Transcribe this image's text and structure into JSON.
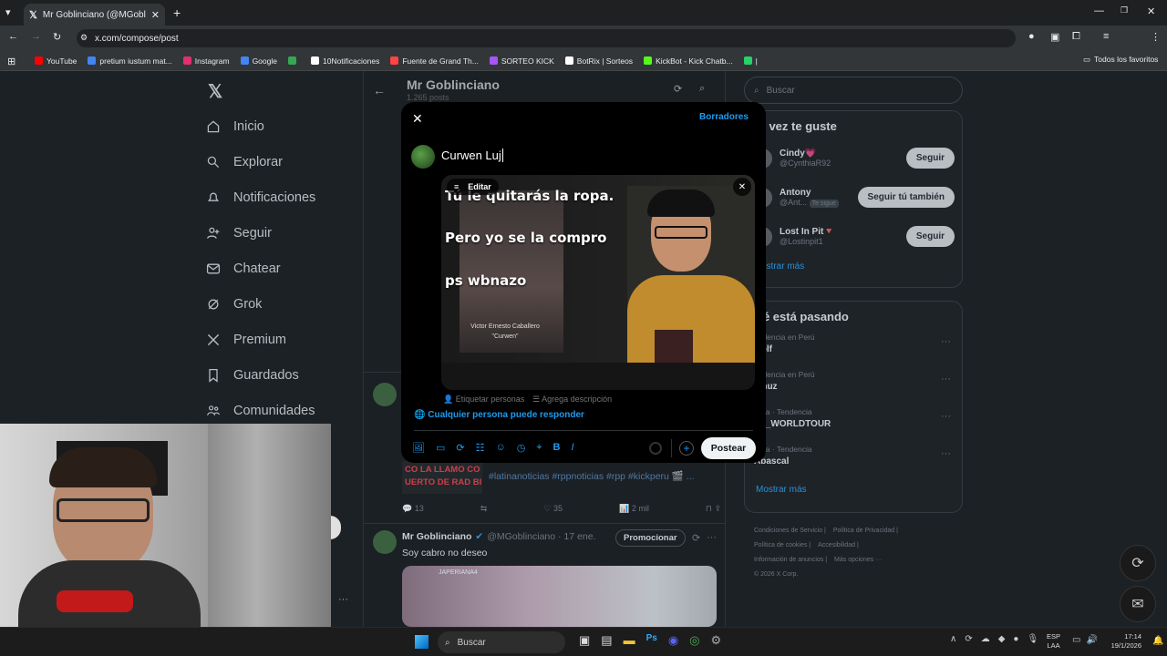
{
  "browser": {
    "tab_title": "Mr Goblinciano (@MGoblinciano",
    "url": "x.com/compose/post",
    "bookmarks": [
      {
        "label": "YouTube",
        "color": "#ff0000"
      },
      {
        "label": "pretium iustum mat...",
        "color": "#4285f4"
      },
      {
        "label": "Instagram",
        "color": "#e1306c"
      },
      {
        "label": "Google",
        "color": "#4285f4"
      },
      {
        "label": "",
        "color": "#34a853"
      },
      {
        "label": "10Notificaciones",
        "color": "#ffffff"
      },
      {
        "label": "Fuente de Grand Th...",
        "color": "#ff4444"
      },
      {
        "label": "SORTEO KICK",
        "color": "#a855f7"
      },
      {
        "label": "BotRix | Sorteos",
        "color": "#ffffff"
      },
      {
        "label": "KickBot - Kick Chatb...",
        "color": "#53fc18"
      },
      {
        "label": "|",
        "color": "#25d366"
      }
    ],
    "all_bookmarks": "Todos los favoritos"
  },
  "nav": [
    {
      "label": "Inicio",
      "icon": "home-icon"
    },
    {
      "label": "Explorar",
      "icon": "search-icon"
    },
    {
      "label": "Notificaciones",
      "icon": "bell-icon"
    },
    {
      "label": "Seguir",
      "icon": "follow-icon"
    },
    {
      "label": "Chatear",
      "icon": "mail-icon"
    },
    {
      "label": "Grok",
      "icon": "grok-icon"
    },
    {
      "label": "Premium",
      "icon": "x-icon"
    },
    {
      "label": "Guardados",
      "icon": "bookmark-icon"
    },
    {
      "label": "Comunidades",
      "icon": "communities-icon"
    }
  ],
  "profile": {
    "name": "Mr Goblinciano",
    "posts": "1.265 posts"
  },
  "timeline": {
    "post1": {
      "banner": "CO LA LLAMO CO\nUERTO DE RAD BI",
      "tags": "#latinanoticias #rppnoticias #rpp #kickperu 🎬 ...",
      "replies": "13",
      "likes": "35",
      "views": "2 mil"
    },
    "post2": {
      "name": "Mr Goblinciano",
      "handle": "@MGoblinciano · 17 ene.",
      "promote": "Promocionar",
      "text": "Soy cabro no deseo",
      "watermark": "JAPERIANA4"
    }
  },
  "search": {
    "placeholder": "Buscar"
  },
  "who_to_follow": {
    "title": "al vez te guste",
    "users": [
      {
        "name": "Cindy💗",
        "handle": "@CynthiaR92",
        "button": "Seguir",
        "badge": ""
      },
      {
        "name": "Antony",
        "handle": "@Ant...",
        "button": "Seguir tú también",
        "badge": "Te sigue"
      },
      {
        "name": "Lost In Pit🔻",
        "handle": "@Lostinpit1",
        "button": "Seguir",
        "badge": ""
      }
    ],
    "more": "ostrar más"
  },
  "trends": {
    "title": "ué está pasando",
    "items": [
      {
        "context": "endencia en Perú",
        "topic": "Golf"
      },
      {
        "context": "endencia en Perú",
        "topic": "amuz"
      },
      {
        "context": "ísica · Tendencia",
        "topic": "TS_WORLDTOUR"
      },
      {
        "context": "lítica · Tendencia",
        "topic": "Abascal"
      }
    ],
    "more": "Mostrar más"
  },
  "footer": [
    "Condiciones de Servicio |",
    "Política de Privacidad |",
    "Política de cookies |",
    "Accesibilidad |",
    "Información de anuncios |",
    "Más opciones ···",
    "© 2026 X Corp."
  ],
  "composer": {
    "drafts": "Borradores",
    "text": "Curwen Luj",
    "edit": "Editar",
    "meme": {
      "line1": "Tú le quitarás la ropa.",
      "line2": "Pero yo se la compro",
      "line3": "ps wbnazo",
      "caption1": "Victor Ernesto Caballero",
      "caption2": "\"Curwen\""
    },
    "tag_people": "Etiquetar personas",
    "add_desc": "Agrega descripción",
    "reply_setting": "Cualquier persona puede responder",
    "post": "Postear"
  },
  "taskbar": {
    "search": "Buscar",
    "lang1": "ESP",
    "lang2": "LAA",
    "time": "17:14",
    "date": "19/1/2026"
  }
}
